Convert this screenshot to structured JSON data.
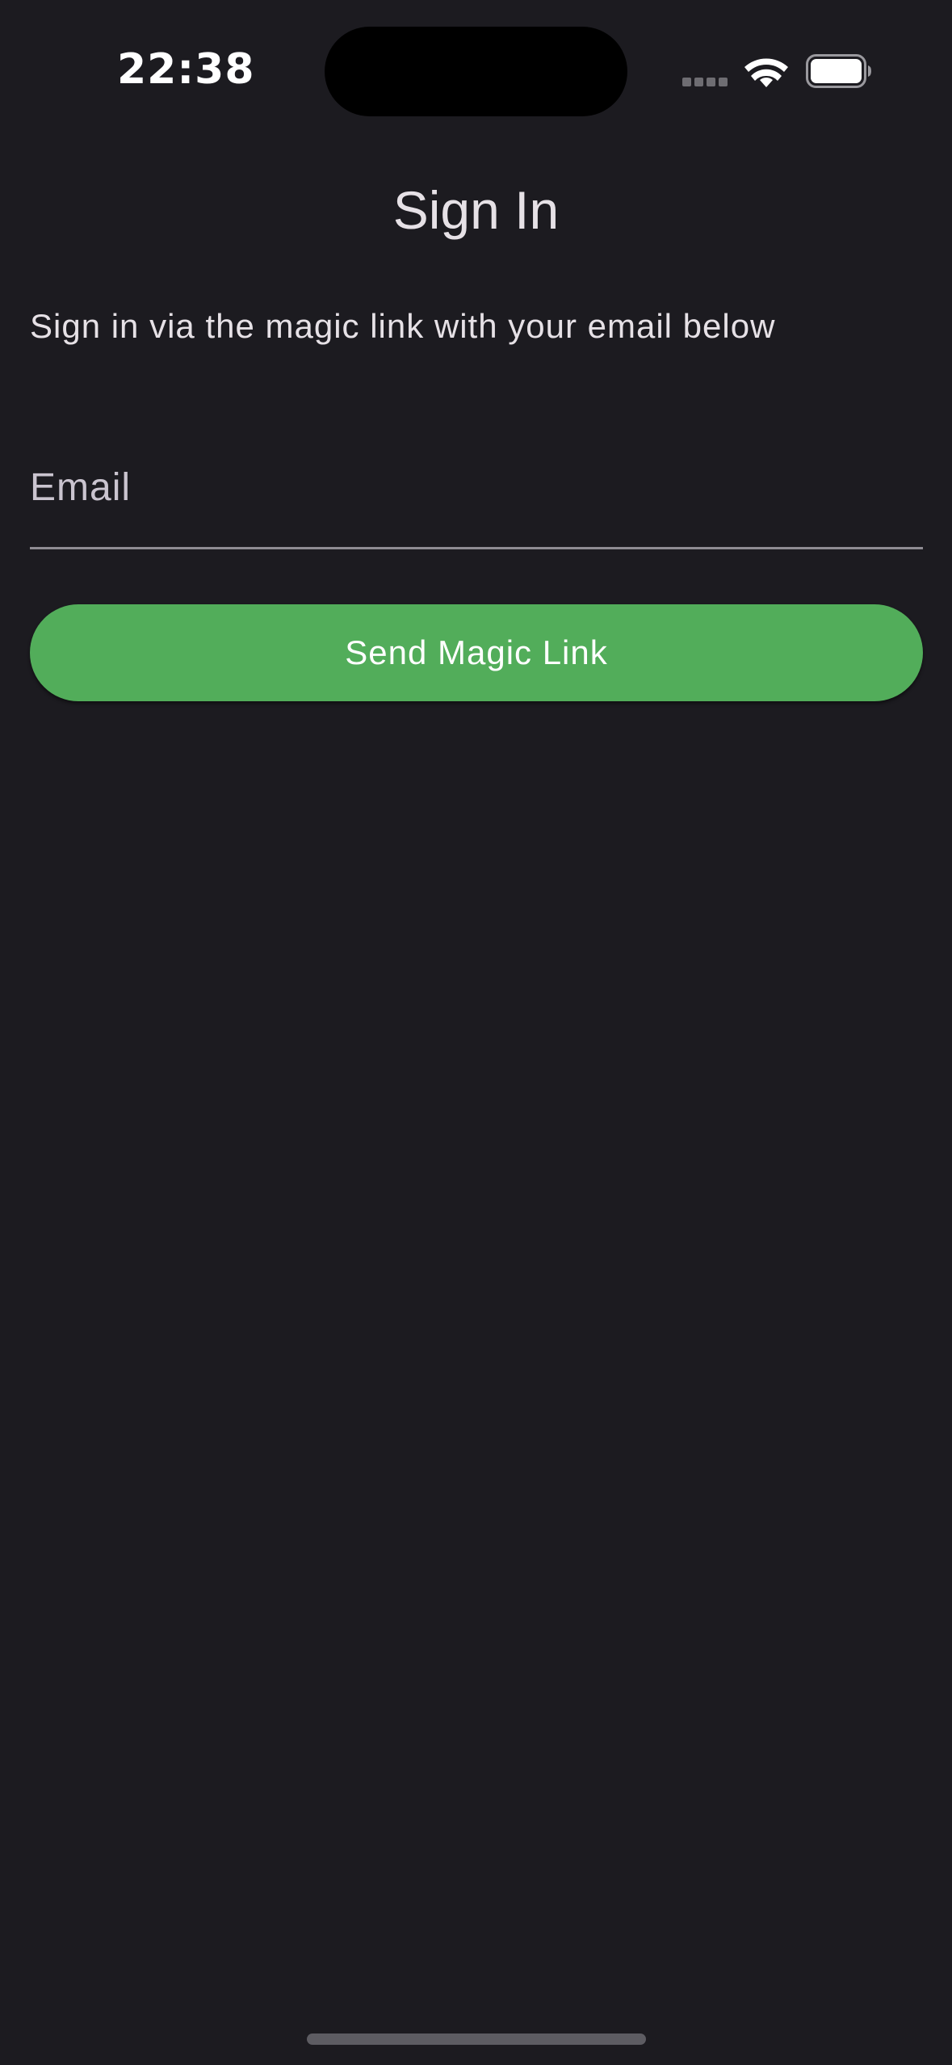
{
  "status_bar": {
    "time": "22:38",
    "icons": [
      "cellular-signal-icon",
      "wifi-icon",
      "battery-icon"
    ]
  },
  "screen": {
    "title": "Sign In",
    "subtitle": "Sign in via the magic link with your email below",
    "email_field": {
      "placeholder": "Email",
      "value": ""
    },
    "send_button_label": "Send Magic Link"
  },
  "colors": {
    "background": "#1c1b20",
    "accent": "#52ad5a",
    "text": "#e6e1e6",
    "underline": "#8f8c93"
  }
}
